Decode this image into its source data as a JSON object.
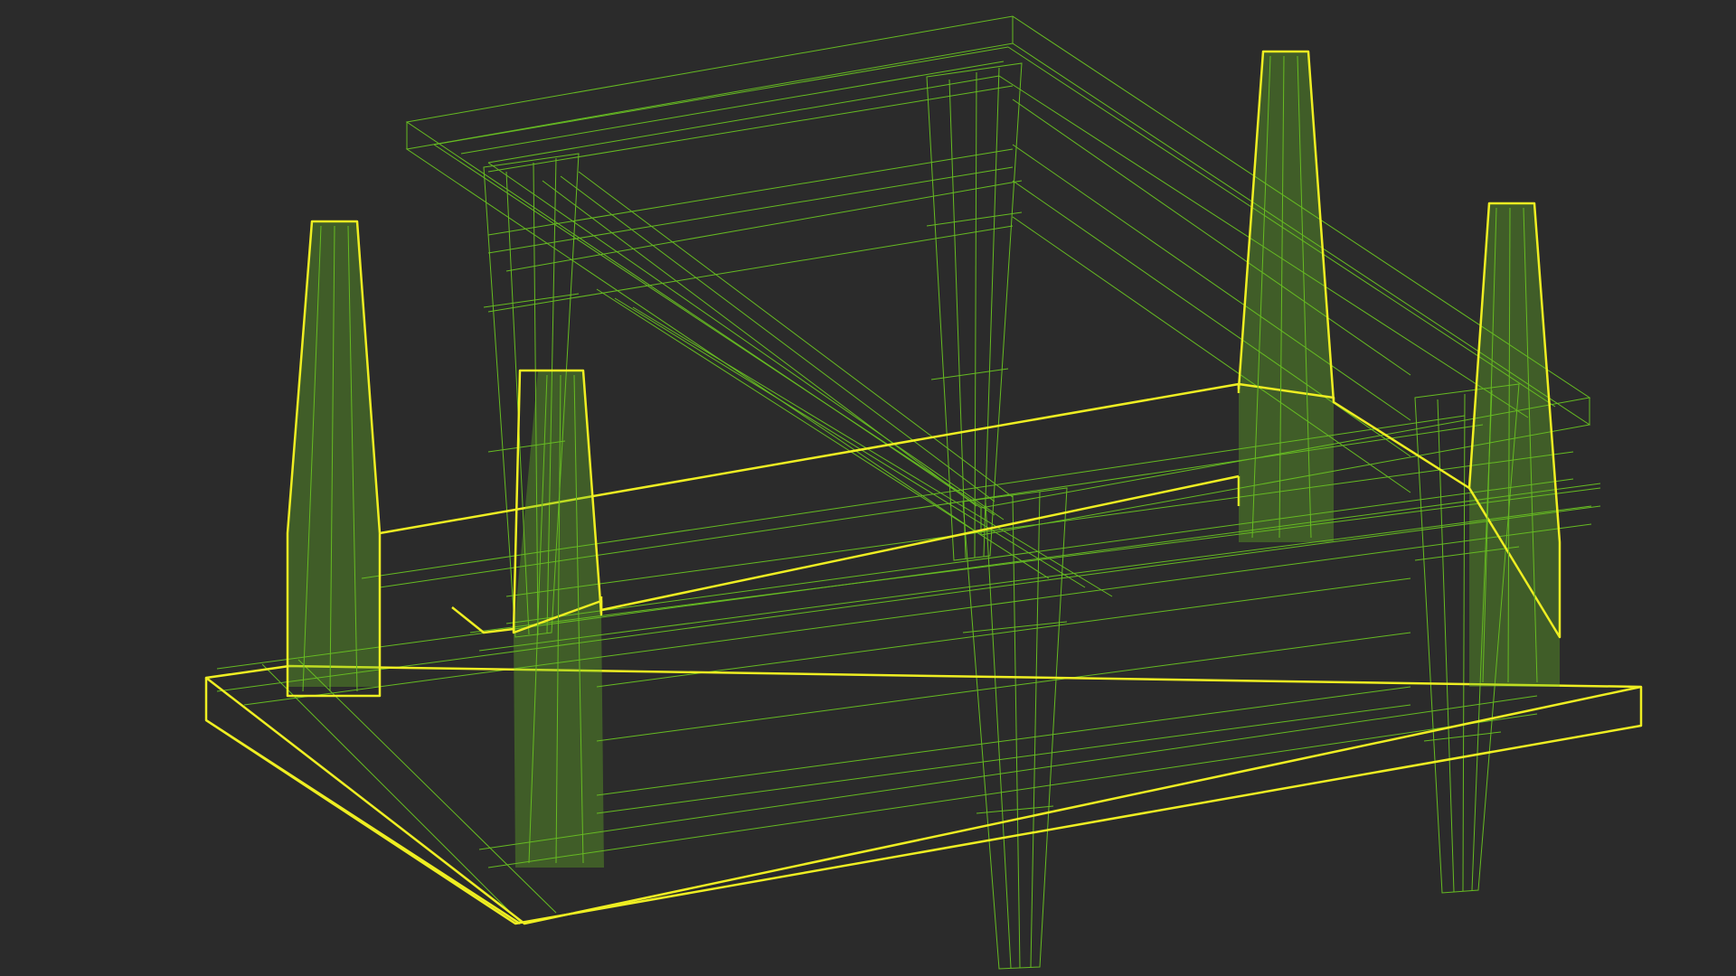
{
  "viewport": {
    "background": "#2b2b2b",
    "wire_color": "#66bb22",
    "highlight_color": "#eeee22",
    "display_mode": "wireframe",
    "scene": [
      {
        "name": "upper-table-top",
        "kind": "slab",
        "selected": false
      },
      {
        "name": "upper-table-leg-back-left",
        "kind": "leg",
        "selected": false
      },
      {
        "name": "upper-table-leg-back-right",
        "kind": "leg",
        "selected": false
      },
      {
        "name": "upper-table-leg-front-left",
        "kind": "leg",
        "selected": false
      },
      {
        "name": "upper-table-leg-front-right",
        "kind": "leg",
        "selected": false
      },
      {
        "name": "selected-table-top",
        "kind": "slab",
        "selected": true
      },
      {
        "name": "selected-table-apron",
        "kind": "frame",
        "selected": true
      },
      {
        "name": "selected-table-leg-back-left",
        "kind": "leg",
        "selected": true
      },
      {
        "name": "selected-table-leg-front-left",
        "kind": "leg",
        "selected": true
      },
      {
        "name": "selected-table-leg-back-right",
        "kind": "leg",
        "selected": true
      },
      {
        "name": "selected-table-leg-front-right",
        "kind": "leg",
        "selected": true
      }
    ]
  }
}
